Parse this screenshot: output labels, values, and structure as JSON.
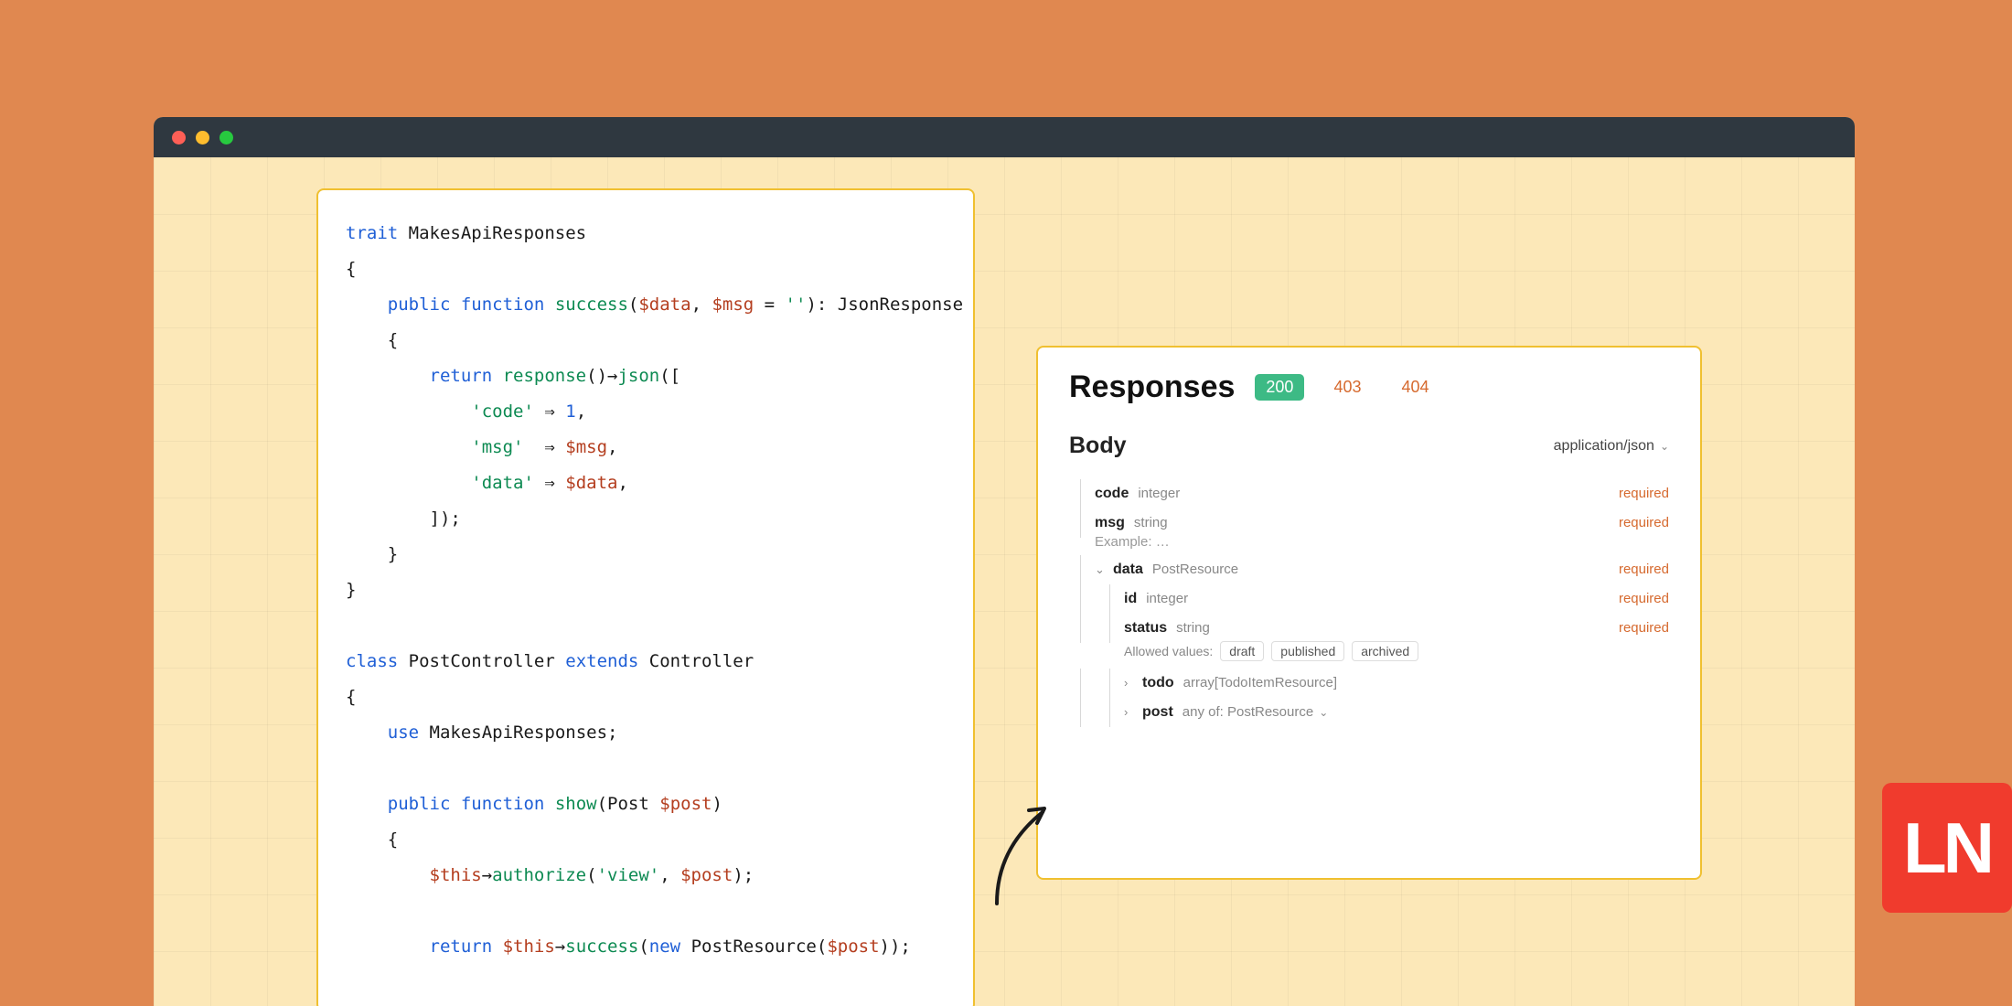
{
  "code": {
    "trait_kw": "trait",
    "trait_name": "MakesApiResponses",
    "public_kw": "public",
    "function_kw": "function",
    "fn_success": "success",
    "param_data": "$data",
    "param_msg": "$msg",
    "default_empty": "''",
    "ret_type": "JsonResponse",
    "return_kw": "return",
    "fn_response": "response",
    "fn_json": "json",
    "key_code": "'code'",
    "key_msg": "'msg'",
    "key_data": "'data'",
    "val_one": "1",
    "class_kw": "class",
    "class_name": "PostController",
    "extends_kw": "extends",
    "parent": "Controller",
    "use_kw": "use",
    "trait_use": "MakesApiResponses",
    "fn_show": "show",
    "param_post_type": "Post",
    "param_post": "$post",
    "var_this": "$this",
    "fn_authorize": "authorize",
    "str_view": "'view'",
    "fn_success2": "success",
    "new_kw": "new",
    "postresource": "PostResource"
  },
  "responses": {
    "title": "Responses",
    "codes": [
      "200",
      "403",
      "404"
    ],
    "body_label": "Body",
    "content_type": "application/json",
    "required_label": "required"
  },
  "schema": {
    "code": {
      "name": "code",
      "type": "integer"
    },
    "msg": {
      "name": "msg",
      "type": "string",
      "example_label": "Example:",
      "example_value": "…"
    },
    "data": {
      "name": "data",
      "type": "PostResource"
    },
    "id": {
      "name": "id",
      "type": "integer"
    },
    "status": {
      "name": "status",
      "type": "string",
      "allowed_label": "Allowed values:",
      "values": [
        "draft",
        "published",
        "archived"
      ]
    },
    "todo": {
      "name": "todo",
      "type": "array[TodoItemResource]"
    },
    "post": {
      "name": "post",
      "type": "any of: PostResource"
    }
  },
  "logo": "LN"
}
